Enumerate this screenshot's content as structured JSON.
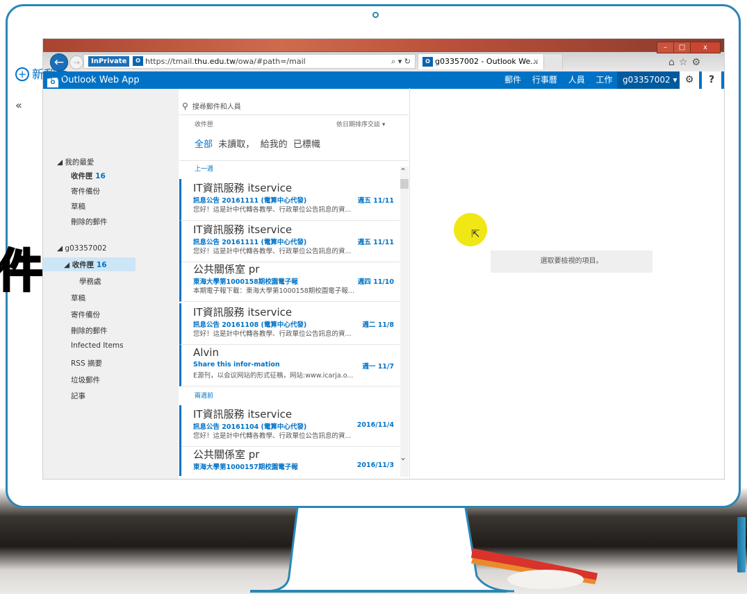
{
  "overlay_glyph": "件",
  "browser": {
    "back_icon": "back-arrow-icon",
    "inprivate_label": "InPrivate",
    "url_prefix": "https://tmail.",
    "url_domain": "thu.edu.tw",
    "url_path": "/owa/#path=/mail",
    "address_icons": "⌕ ▾ ↻",
    "tab_title": "g03357002 - Outlook We...",
    "tab_close": "×",
    "window_buttons": [
      "–",
      "□",
      "x"
    ],
    "toolbar_icons": "⌂☆⚙"
  },
  "owa": {
    "app_name": "Outlook Web App",
    "nav": [
      "郵件",
      "行事曆",
      "人員",
      "工作"
    ],
    "user": "g03357002 ▾",
    "settings_icon": "⚙",
    "help_label": "?"
  },
  "sidebar": {
    "new_mail": "新郵件",
    "collapse": "«",
    "favorites_header": "◢ 我的最愛",
    "favorites": [
      {
        "label": "收件匣",
        "count": "16"
      },
      {
        "label": "寄件備份",
        "count": ""
      },
      {
        "label": "草稿",
        "count": ""
      },
      {
        "label": "刪除的郵件",
        "count": ""
      }
    ],
    "account_header": "◢ g03357002",
    "inbox": {
      "label": "◢ 收件匣",
      "count": "16"
    },
    "folders": [
      "學務處",
      "草稿",
      "寄件備份",
      "刪除的郵件",
      "Infected Items",
      "RSS 摘要",
      "垃圾郵件",
      "記事"
    ]
  },
  "list": {
    "search_placeholder": "搜尋郵件和人員",
    "folder_label": "收件匣",
    "sort_label": "依日期排序交談 ▾",
    "filter_all": "全部",
    "filter_unread": "未讀取，",
    "filter_tome": "給我的",
    "filter_flagged": "已標幟",
    "group_last_week": "上一週",
    "group_two_weeks": "兩週前",
    "messages": [
      {
        "sender": "IT資訊服務 itservice",
        "subject": "訊息公告 20161111 (電算中心代發)",
        "date": "週五 11/11",
        "preview": "您好！這是計中代轉各教學、行政單位公告訊息的資..."
      },
      {
        "sender": "IT資訊服務 itservice",
        "subject": "訊息公告 20161111 (電算中心代發)",
        "date": "週五 11/11",
        "preview": "您好！這是計中代轉各教學、行政單位公告訊息的資..."
      },
      {
        "sender": "公共關係室 pr",
        "subject": "東海大學第1000158期校園電子報",
        "date": "週四 11/10",
        "preview": "本期電子報下載：東海大學第1000158期校園電子報..."
      },
      {
        "sender": "IT資訊服務 itservice",
        "subject": "訊息公告 20161108 (電算中心代發)",
        "date": "週二 11/8",
        "preview": "您好！這是計中代轉各教學、行政單位公告訊息的資..."
      },
      {
        "sender": "Alvin",
        "subject": "Share this infor-mation",
        "date": "週一 11/7",
        "preview": "E源刊，以会议网站的形式征稿，网站:www.icarja.o..."
      },
      {
        "sender": "IT資訊服務 itservice",
        "subject": "訊息公告 20161104 (電算中心代發)",
        "date": "2016/11/4",
        "preview": "您好！這是計中代轉各教學、行政單位公告訊息的資..."
      },
      {
        "sender": "公共關係室 pr",
        "subject": "東海大學第1000157期校園電子報",
        "date": "2016/11/3",
        "preview": ""
      }
    ]
  },
  "reading_pane": {
    "empty_message": "選取要檢視的項目。"
  },
  "colors": {
    "owa_blue": "#0072c6",
    "monitor_frame": "#2a86b4",
    "cursor_highlight": "#f0e500"
  }
}
